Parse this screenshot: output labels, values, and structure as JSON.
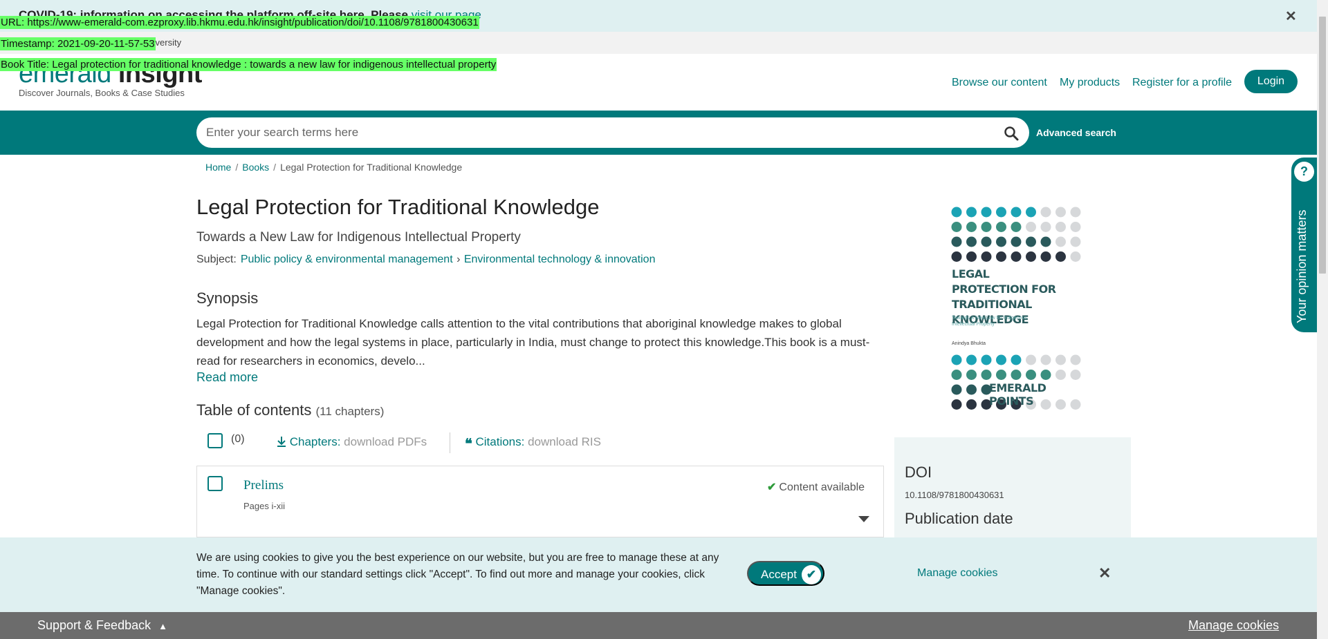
{
  "covid": {
    "text": "COVID-19: information on accessing the platform off-site here. Please",
    "link": "visit our page",
    "close": "✕"
  },
  "institution": {
    "text": "University"
  },
  "overlays": {
    "url": "URL: https://www-emerald-com.ezproxy.lib.hkmu.edu.hk/insight/publication/doi/10.1108/9781800430631",
    "timestamp": "Timestamp: 2021-09-20-11-57-53",
    "book_title": "Book Title: Legal protection for traditional knowledge : towards a new law for indigenous intellectual property"
  },
  "header": {
    "logo_light": "emerald",
    "logo_bold": "insight",
    "logo_sub": "Discover Journals, Books & Case Studies",
    "nav": [
      "Browse our content",
      "My products",
      "Register for a profile"
    ],
    "login": "Login"
  },
  "search": {
    "placeholder": "Enter your search terms here",
    "advanced": "Advanced search"
  },
  "breadcrumb": [
    "Home",
    "Books",
    "Legal Protection for Traditional Knowledge"
  ],
  "book": {
    "title": "Legal Protection for Traditional Knowledge",
    "subtitle": "Towards a New Law for Indigenous Intellectual Property",
    "subject_label": "Subject:",
    "subject_primary": "Public policy & environmental management",
    "subject_secondary": "Environmental technology & innovation"
  },
  "synopsis": {
    "heading": "Synopsis",
    "text": "Legal Protection for Traditional Knowledge calls attention to the vital contributions that aboriginal knowledge makes to global development and how the legal systems in place, particularly in India, must change to protect this knowledge.This book is a must-read for researchers in economics, develo...",
    "read_more": "Read more"
  },
  "toc": {
    "heading": "Table of contents",
    "count": "(11 chapters)",
    "selected": "(0)",
    "chapters_label": "Chapters:",
    "chapters_action": "download PDFs",
    "citations_label": "Citations:",
    "citations_action": "download RIS",
    "items": [
      {
        "title": "Prelims",
        "pages": "Pages i-xii",
        "status": "Content available"
      }
    ]
  },
  "cover": {
    "title": "LEGAL PROTECTION FOR TRADITIONAL KNOWLEDGE",
    "subtitle": "Towards a New Law for Indigenous Intellectual Property",
    "author": "Anindya Bhukta",
    "series": "EMERALD POINTS",
    "colors": {
      "teal_light": "#1ba3b5",
      "teal_mid": "#3a8f7f",
      "teal_dark": "#2a5a5c",
      "navy": "#2b3440",
      "grey": "#d6d8da"
    }
  },
  "details": {
    "doi_heading": "DOI",
    "doi": "10.1108/9781800430631",
    "pub_heading": "Publication date"
  },
  "opinion": {
    "label": "Your opinion matters",
    "icon": "?"
  },
  "cookies": {
    "text": "We are using cookies to give you the best experience on our website, but you are free to manage these at any time. To continue with our standard settings click \"Accept\". To find out more and manage your cookies, click \"Manage cookies\".",
    "accept": "Accept",
    "manage": "Manage cookies",
    "close": "✕"
  },
  "footer": {
    "support": "Support & Feedback",
    "manage": "Manage cookies"
  },
  "colors": {
    "brand": "#00797b",
    "highlight": "#66ff66"
  }
}
